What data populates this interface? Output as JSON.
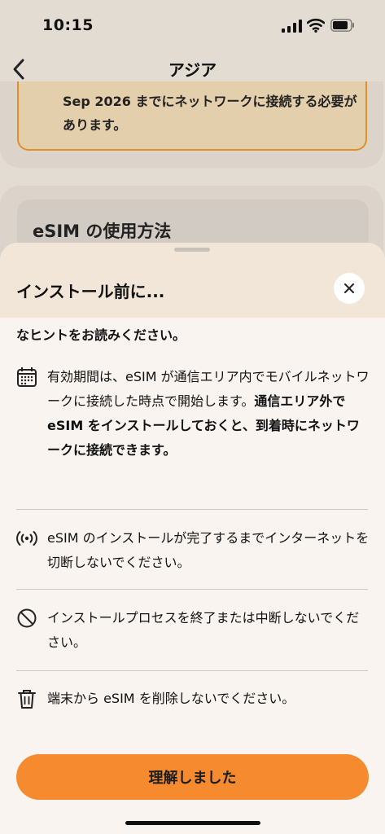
{
  "status_bar": {
    "time": "10:15"
  },
  "header": {
    "title": "アジア"
  },
  "background": {
    "warning_text": "Sep 2026 までにネットワークに接続する必要があります。",
    "card_title": "eSIM の使用方法"
  },
  "sheet": {
    "title": "インストール前に...",
    "intro": "なヒントをお読みください。",
    "tips": [
      {
        "icon": "calendar-icon",
        "text_normal": "有効期間は、eSIM が通信エリア内でモバイルネットワークに接続した時点で開始します。",
        "text_bold": "通信エリア外で eSIM をインストールしておくと、到着時にネットワークに接続できます。"
      },
      {
        "icon": "signal-broadcast-icon",
        "text": "eSIM のインストールが完了するまでインターネットを切断しないでください。"
      },
      {
        "icon": "prohibited-icon",
        "text": "インストールプロセスを終了または中断しないでください。"
      },
      {
        "icon": "trash-icon",
        "text": "端末から eSIM を削除しないでください。"
      }
    ],
    "confirm_label": "理解しました"
  },
  "colors": {
    "accent": "#f58a2e",
    "warning_border": "#e0902a",
    "sheet_bg": "#f9f4f0"
  }
}
